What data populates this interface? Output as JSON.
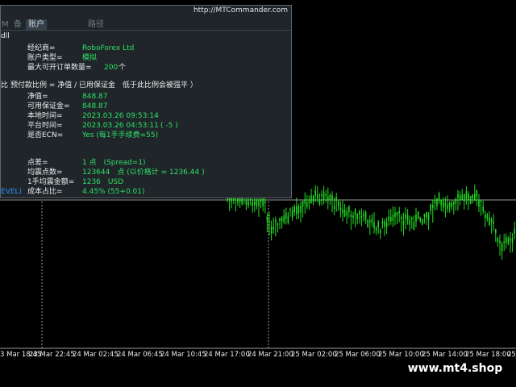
{
  "panel": {
    "url": "http://MTCommander.com",
    "tabs": [
      "M",
      "备",
      "账户",
      "路径"
    ],
    "active_tab": "账户",
    "edge_label": "dll",
    "rows": {
      "broker_label": "经纪商=",
      "broker_value": "RoboForex Ltd",
      "account_type_label": "账户类型=",
      "account_type_value": "模拟",
      "max_orders_label": "最大可开订单数量=",
      "max_orders_value": "200",
      "max_orders_unit": "个",
      "margin_note": "预付款比例 = 净值 / 已用保证金　低于此比例会被强平 ）",
      "margin_note_prefix": "比",
      "equity_label": "净值=",
      "equity_value": "848.87",
      "free_margin_label": "可用保证金=",
      "free_margin_value": "848.87",
      "local_time_label": "本地时间=",
      "local_time_value": "2023.03.26 09:53:14",
      "platform_time_label": "平台时间=",
      "platform_time_value": "2023.03.26 04:53:11",
      "platform_time_offset": "( -5 )",
      "ecn_label": "是否ECN=",
      "ecn_value": "Yes (每1手手续费=55)",
      "spread_label": "点差=",
      "spread_value": "1 点　(Spread=1)",
      "avg_move_label": "均震点数=",
      "avg_move_value": "123644　点 (以价格计 = 1236.44 )",
      "lot_amount_label": "1手均震金额=",
      "lot_amount_value": "1236　USD",
      "cost_ratio_label": "成本占比=",
      "cost_ratio_value": "4.45% (55+0.01)",
      "level_fragment": "EVEL)"
    }
  },
  "chart": {
    "time_labels": [
      "3 Mar 18:45",
      "23 Mar 22:45",
      "24 Mar 02:45",
      "24 Mar 06:45",
      "24 Mar 10:45",
      "24 Mar 17:00",
      "24 Mar 21:00",
      "25 Mar 02:00",
      "25 Mar 06:00",
      "25 Mar 10:00",
      "25 Mar 14:00",
      "25 Mar 18:00",
      "25"
    ],
    "bull_color": "#22dd22",
    "bg": "#000000",
    "price_line_color": "#aaaaaa"
  },
  "watermark": "www.mt4.shop"
}
